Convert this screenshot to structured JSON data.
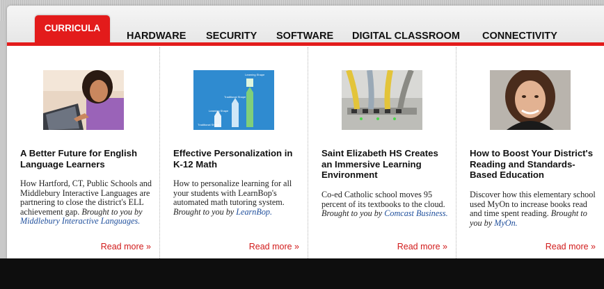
{
  "nav": {
    "tabs": [
      {
        "label": "CURRICULA",
        "active": true
      },
      {
        "label": "HARDWARE"
      },
      {
        "label": "SECURITY"
      },
      {
        "label": "SOFTWARE"
      },
      {
        "label": "DIGITAL CLASSROOM"
      },
      {
        "label": "CONNECTIVITY"
      }
    ]
  },
  "accent_color": "#e31b1b",
  "cards": [
    {
      "title": "A Better Future for English Language Learners",
      "body": "How Hartford, CT, Public Schools and Middlebury Interactive Languages are partnering to close the district's ELL achievement gap.",
      "brought_by": "Brought to you by",
      "sponsor": "Middlebury Interactive Languages.",
      "read_more": "Read more »"
    },
    {
      "title": "Effective Personalization in K-12 Math",
      "body": "How to personalize learning for all your students with LearnBop's automated math tutoring system.",
      "brought_by": "Brought to you by",
      "sponsor": "LearnBop.",
      "read_more": "Read more »",
      "image_labels": [
        "Learning Shape",
        "Traditional Shape",
        "Traditional Shape",
        "Learning Shape"
      ]
    },
    {
      "title": "Saint Elizabeth HS Creates an Immersive Learning Environment",
      "body": "Co-ed Catholic school moves 95 percent of its textbooks to the cloud.",
      "brought_by": "Brought to you by",
      "sponsor": "Comcast Business.",
      "read_more": "Read more »"
    },
    {
      "title": "How to Boost Your District's Reading and Standards-Based Education",
      "body": "Discover how this elementary school used MyOn to increase books read and time spent reading.",
      "brought_by": "Brought to you by",
      "sponsor": "MyOn.",
      "read_more": "Read more »"
    }
  ]
}
